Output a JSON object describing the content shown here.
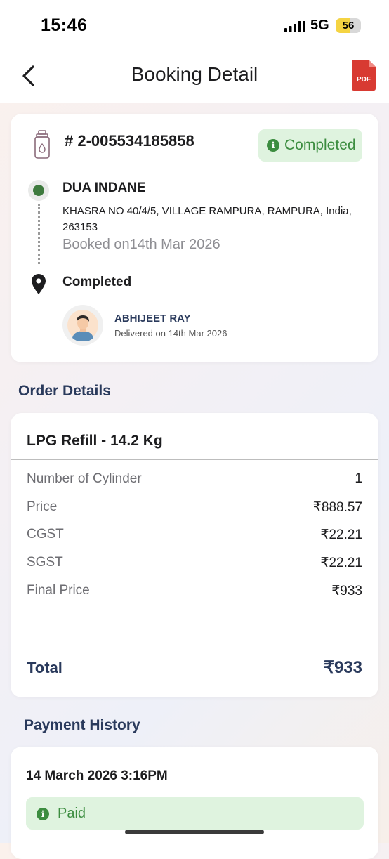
{
  "status_bar": {
    "time": "15:46",
    "network": "5G",
    "battery": "56",
    "battery_level": 0.56
  },
  "header": {
    "title": "Booking Detail",
    "pdf_label": "PDF"
  },
  "booking": {
    "order_id": "# 2-005534185858",
    "status_badge": "Completed",
    "dealer_name": "DUA INDANE",
    "address": "KHASRA NO 40/4/5, VILLAGE RAMPURA, RAMPURA, India, 263153",
    "booked_on": "Booked on14th Mar 2026",
    "delivery_status": "Completed",
    "delivery_person": "ABHIJEET RAY",
    "delivered_on": "Delivered on 14th Mar 2026"
  },
  "order_details": {
    "section_title": "Order Details",
    "product": "LPG Refill - 14.2 Kg",
    "rows": [
      {
        "label": "Number of Cylinder",
        "value": "1"
      },
      {
        "label": "Price",
        "value": "₹888.57"
      },
      {
        "label": "CGST",
        "value": "₹22.21"
      },
      {
        "label": "SGST",
        "value": "₹22.21"
      },
      {
        "label": "Final Price",
        "value": "₹933"
      }
    ],
    "total_label": "Total",
    "total_value": "₹933"
  },
  "payment_history": {
    "section_title": "Payment History",
    "date": "14 March 2026 3:16PM",
    "status": "Paid"
  },
  "colors": {
    "accent_green": "#3c8d40",
    "navy": "#2a3a5c",
    "pdf_red": "#d83a32"
  }
}
